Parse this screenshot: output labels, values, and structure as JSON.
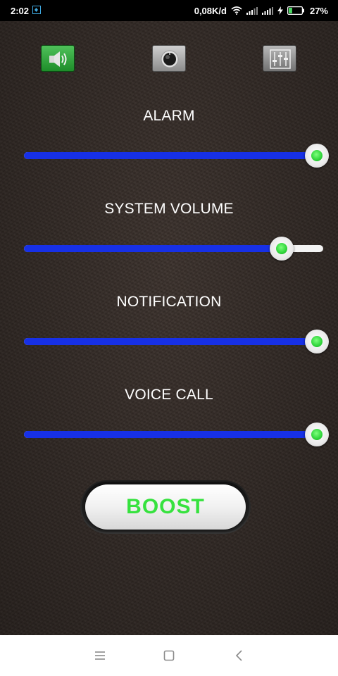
{
  "status_bar": {
    "time": "2:02",
    "network_speed": "0,08K/d",
    "battery_percent": "27%",
    "battery_level": 0.27,
    "icons": [
      "notification-icon",
      "wifi-icon",
      "signal-icon",
      "signal-icon",
      "charging-icon",
      "battery-icon"
    ]
  },
  "tabs": [
    {
      "name": "volume",
      "icon": "speaker-icon",
      "active": true
    },
    {
      "name": "bass",
      "icon": "knob-icon",
      "active": false
    },
    {
      "name": "equalizer",
      "icon": "equalizer-icon",
      "active": false
    }
  ],
  "sliders": [
    {
      "label": "ALARM",
      "value": 1.0
    },
    {
      "label": "SYSTEM VOLUME",
      "value": 0.86
    },
    {
      "label": "NOTIFICATION",
      "value": 1.0
    },
    {
      "label": "VOICE CALL",
      "value": 1.0
    }
  ],
  "boost": {
    "label": "BOOST"
  },
  "nav": {
    "icons": [
      "menu-icon",
      "home-icon",
      "back-icon"
    ]
  },
  "colors": {
    "track_fill": "#1730e6",
    "thumb_center": "#2fd43a",
    "boost_text": "#36e23e",
    "active_tab": "#2fa63a"
  }
}
